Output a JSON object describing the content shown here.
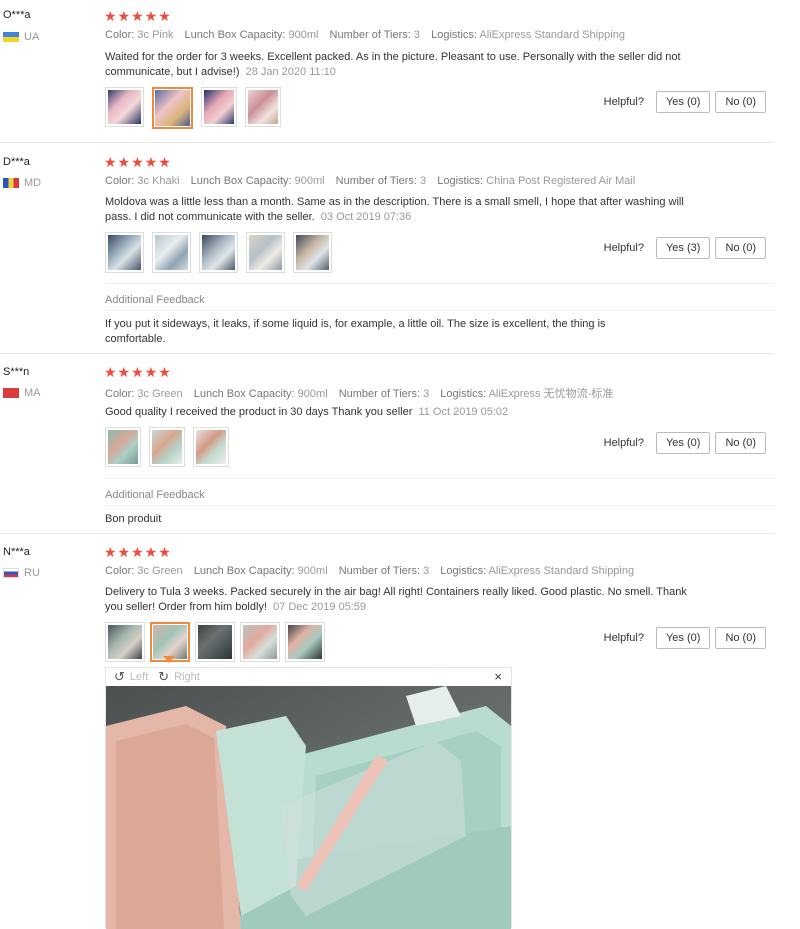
{
  "reviews": [
    {
      "user": "O***a",
      "country": "UA",
      "stars": "★★★★★",
      "attrs": {
        "color_label": "Color:",
        "color": "3c Pink",
        "capacity_label": "Lunch Box Capacity:",
        "capacity": "900ml",
        "tiers_label": "Number of Tiers:",
        "tiers": "3",
        "logistics_label": "Logistics:",
        "logistics": "AliExpress Standard Shipping"
      },
      "text": "Waited for the order for 3 weeks. Excellent packed. As in the picture. Pleasant to use. Personally with the seller did not communicate, but I advise!)",
      "date": "28 Jan 2020 11:10",
      "helpful": "Helpful?",
      "yes": "Yes (0)",
      "no": "No (0)"
    },
    {
      "user": "D***a",
      "country": "MD",
      "stars": "★★★★★",
      "attrs": {
        "color_label": "Color:",
        "color": "3c Khaki",
        "capacity_label": "Lunch Box Capacity:",
        "capacity": "900ml",
        "tiers_label": "Number of Tiers:",
        "tiers": "3",
        "logistics_label": "Logistics:",
        "logistics": "China Post Registered Air Mail"
      },
      "text": "Moldova was a little less than a month. Same as in the description. There is a small smell, I hope that after washing will pass. I did not communicate with the seller.",
      "date": "03 Oct 2019 07:36",
      "helpful": "Helpful?",
      "yes": "Yes (3)",
      "no": "No (0)",
      "feedback_title": "Additional Feedback",
      "feedback": "If you put it sideways, it leaks, if some liquid is, for example, a little oil. The size is excellent, the thing is comfortable."
    },
    {
      "user": "S***n",
      "country": "MA",
      "stars": "★★★★★",
      "attrs": {
        "color_label": "Color:",
        "color": "3c Green",
        "capacity_label": "Lunch Box Capacity:",
        "capacity": "900ml",
        "tiers_label": "Number of Tiers:",
        "tiers": "3",
        "logistics_label": "Logistics:",
        "logistics": "AliExpress 无忧物流-标准"
      },
      "text": "Good quality I received the product in 30 days Thank you seller",
      "date": "11 Oct 2019 05:02",
      "helpful": "Helpful?",
      "yes": "Yes (0)",
      "no": "No (0)",
      "feedback_title": "Additional Feedback",
      "feedback": "Bon produit"
    },
    {
      "user": "N***a",
      "country": "RU",
      "stars": "★★★★★",
      "attrs": {
        "color_label": "Color:",
        "color": "3c Green",
        "capacity_label": "Lunch Box Capacity:",
        "capacity": "900ml",
        "tiers_label": "Number of Tiers:",
        "tiers": "3",
        "logistics_label": "Logistics:",
        "logistics": "AliExpress Standard Shipping"
      },
      "text": "Delivery to Tula 3 weeks. Packed securely in the air bag! All right! Containers really liked. Good plastic. No smell. Thank you seller! Order from him boldly!",
      "date": "07 Dec 2019 05:59",
      "helpful": "Helpful?",
      "yes": "Yes (0)",
      "no": "No (0)"
    }
  ],
  "viewer": {
    "rotate_left_icon": "rotate-left-icon",
    "left_label": "Left",
    "rotate_right_icon": "rotate-right-icon",
    "right_label": "Right",
    "close": "×"
  },
  "colors": {
    "star": "#f04b3d",
    "selected_thumb": "#f08b3c"
  }
}
